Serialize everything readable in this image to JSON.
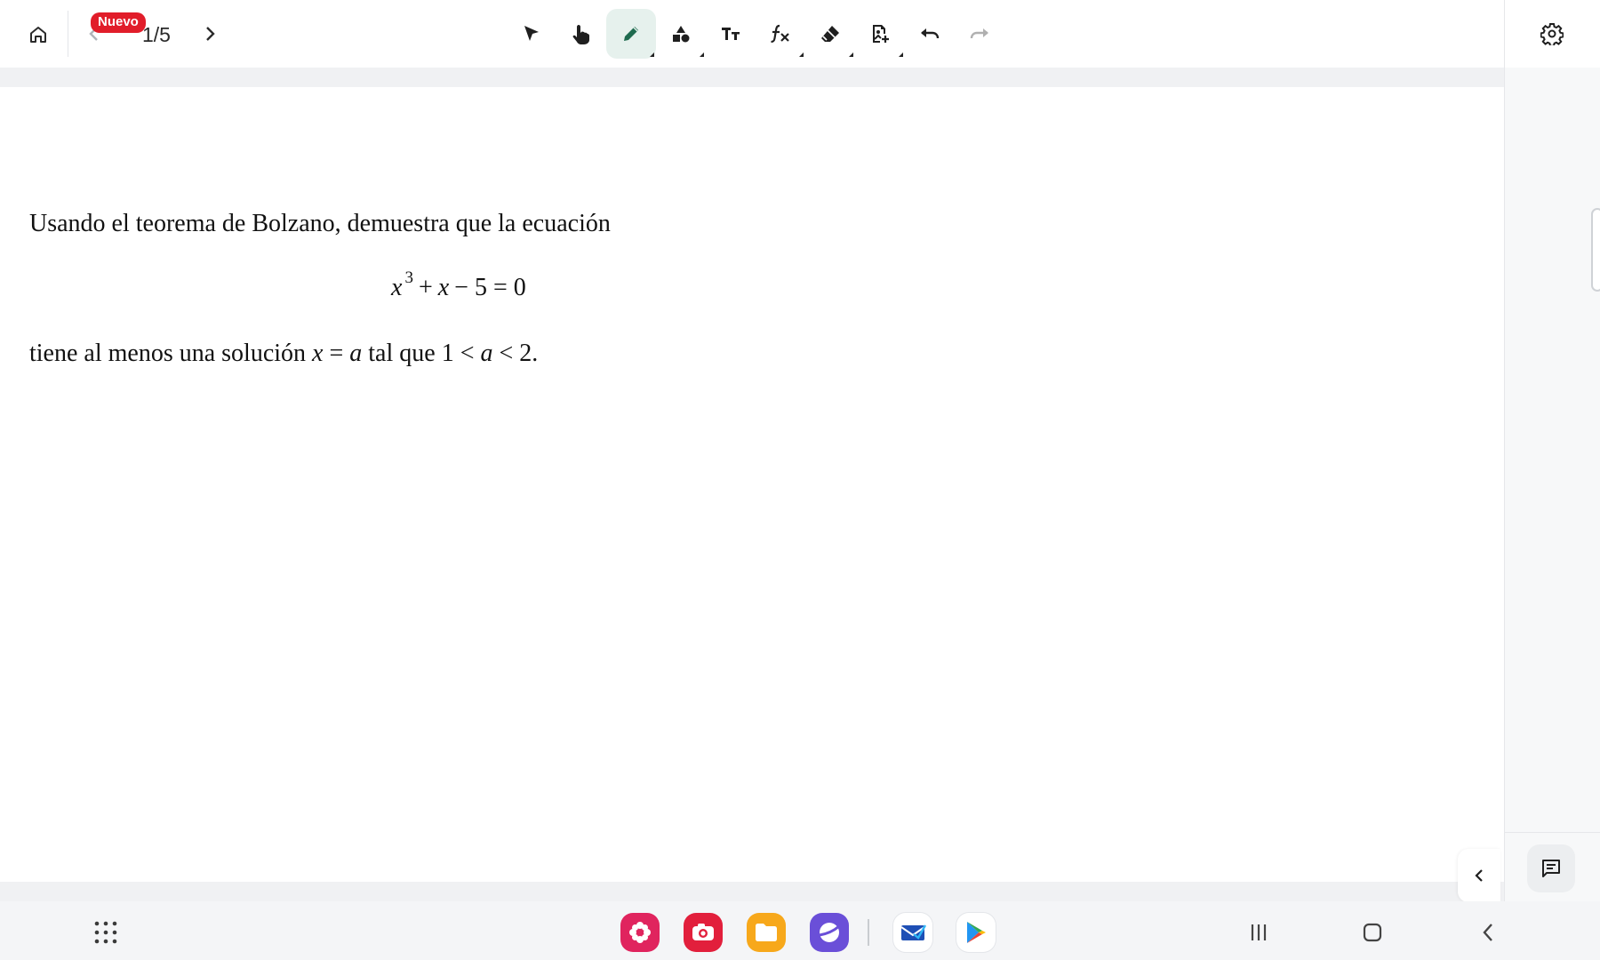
{
  "toolbar": {
    "badge_new": "Nuevo",
    "page_indicator": "1/5",
    "tools": [
      {
        "name": "select-tool",
        "icon": "arrow-pointer-icon"
      },
      {
        "name": "pan-tool",
        "icon": "hand-pointer-icon"
      },
      {
        "name": "pen-tool",
        "icon": "pencil-icon",
        "active": true
      },
      {
        "name": "shapes-tool",
        "icon": "shapes-icon"
      },
      {
        "name": "text-tool",
        "icon": "text-size-icon",
        "glyph": "Tт"
      },
      {
        "name": "formula-tool",
        "icon": "function-fx-icon",
        "glyph": "ƒx"
      },
      {
        "name": "eraser-tool",
        "icon": "eraser-icon"
      },
      {
        "name": "insert-image-tool",
        "icon": "add-image-icon"
      },
      {
        "name": "undo-button",
        "icon": "undo-icon"
      },
      {
        "name": "redo-button",
        "icon": "redo-icon",
        "disabled": true
      }
    ]
  },
  "problem": {
    "line1": "Usando el teorema de Bolzano, demuestra que la ecuación",
    "eq_x": "x",
    "eq_exp": "3",
    "eq_rest_plus": "+",
    "eq_rest_x": "x",
    "eq_rest_tail": "− 5 = 0",
    "line2_pre": "tiene al menos una solución ",
    "line2_x": "x",
    "line2_eq": " = ",
    "line2_a": "a",
    "line2_mid": " tal que 1 < ",
    "line2_a2": "a",
    "line2_end": " < 2."
  },
  "colors": {
    "accent_active": "#e6f1ed",
    "pen_green": "#1f6b4f",
    "badge_red": "#e11d2a"
  },
  "dock": {
    "apps": [
      "flower-app-icon",
      "camera-app-icon",
      "files-app-icon",
      "internet-app-icon",
      "email-app-icon",
      "play-store-app-icon"
    ]
  }
}
